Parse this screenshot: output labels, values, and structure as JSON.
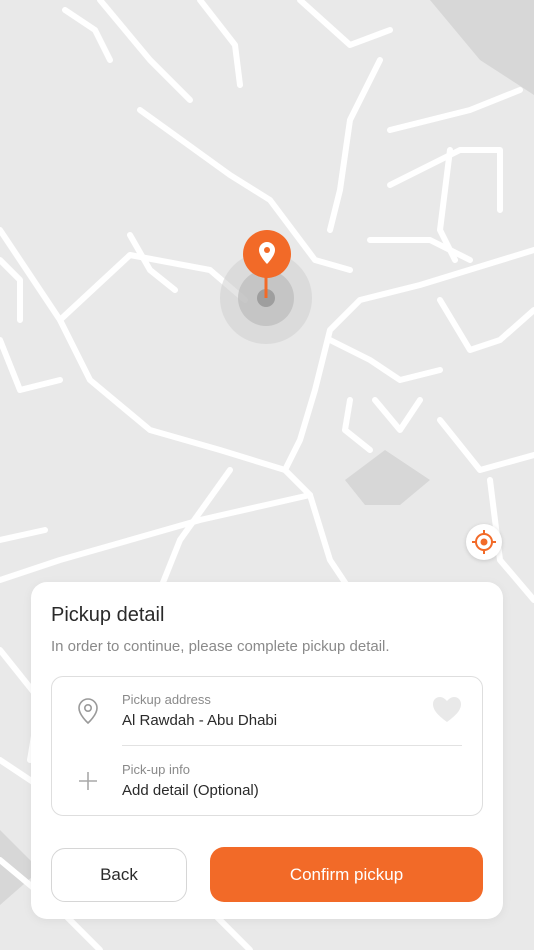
{
  "colors": {
    "accent": "#f26a28",
    "map_bg": "#e9e9e9",
    "road": "#ffffff",
    "block": "#d7d7d7"
  },
  "map": {
    "pin_icon": "location-pin-icon",
    "locate_icon": "crosshair-target-icon"
  },
  "sheet": {
    "title": "Pickup detail",
    "subtitle": "In order to continue, please complete pickup detail.",
    "pickup_address": {
      "icon": "map-pin-outline-icon",
      "label": "Pickup address",
      "value": "Al Rawdah - Abu Dhabi",
      "favorite_icon": "heart-icon"
    },
    "pickup_info": {
      "icon": "plus-icon",
      "label": "Pick-up info",
      "value": "Add detail (Optional)"
    },
    "back_label": "Back",
    "confirm_label": "Confirm pickup"
  }
}
